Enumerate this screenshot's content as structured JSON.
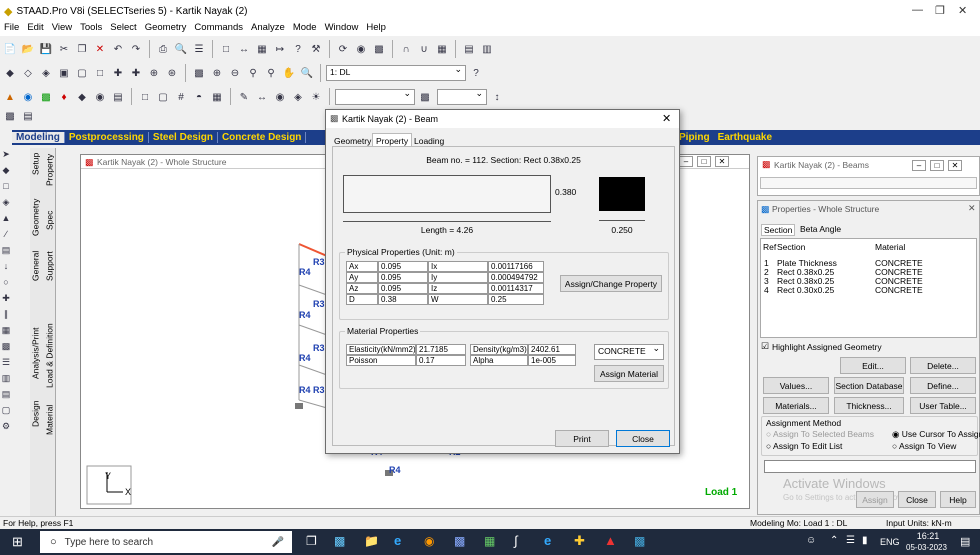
{
  "app": {
    "title": "STAAD.Pro V8i (SELECTseries 5) - Kartik Nayak (2)",
    "menu": [
      "File",
      "Edit",
      "View",
      "Tools",
      "Select",
      "Geometry",
      "Commands",
      "Analyze",
      "Mode",
      "Window",
      "Help"
    ],
    "load_combo": "1: DL"
  },
  "page_tabs": [
    "Modeling",
    "Postprocessing",
    "Steel Design",
    "Concrete Design"
  ],
  "page_tabs_right": [
    "Piping",
    "Earthquake"
  ],
  "side_tabs": [
    "Setup",
    "Property",
    "Geometry",
    "Spec",
    "General",
    "Support",
    "Analysis/Print",
    "Load & Definition",
    "Design",
    "Material"
  ],
  "structure_window": {
    "title": "Kartik Nayak (2) - Whole Structure",
    "labels": [
      "R3",
      "R4",
      "R3",
      "R4",
      "R3",
      "R4",
      "R4",
      "R3",
      "R4",
      "R4",
      "R2"
    ],
    "load_label": "Load 1",
    "axis_y": "Y",
    "axis_x": "X"
  },
  "beams_window": {
    "title": "Kartik Nayak (2) - Beams"
  },
  "properties_window": {
    "title": "Properties - Whole Structure",
    "tabs": [
      "Section",
      "Beta Angle"
    ],
    "columns": [
      "Ref",
      "Section",
      "Material"
    ],
    "rows": [
      {
        "ref": "1",
        "section": "Plate Thickness",
        "material": "CONCRETE"
      },
      {
        "ref": "2",
        "section": "Rect 0.38x0.25",
        "material": "CONCRETE"
      },
      {
        "ref": "3",
        "section": "Rect 0.38x0.25",
        "material": "CONCRETE"
      },
      {
        "ref": "4",
        "section": "Rect 0.30x0.25",
        "material": "CONCRETE"
      }
    ],
    "highlight_label": "Highlight Assigned Geometry",
    "buttons": {
      "edit": "Edit...",
      "delete": "Delete...",
      "values": "Values...",
      "section_db": "Section Database",
      "define": "Define...",
      "materials": "Materials...",
      "thickness": "Thickness...",
      "user_table": "User Table...",
      "assign": "Assign",
      "close": "Close",
      "help": "Help"
    },
    "assignment_method": "Assignment Method",
    "radio": [
      "Assign To Selected Beams",
      "Use Cursor To Assign",
      "Assign To Edit List",
      "Assign To View"
    ],
    "watermark": "Activate Windows",
    "watermark_sub": "Go to Settings to activate Windows."
  },
  "dialog": {
    "title": "Kartik Nayak (2) - Beam",
    "tabs": [
      "Geometry",
      "Property",
      "Loading"
    ],
    "beam_info": "Beam no. = 112. Section: Rect 0.38x0.25",
    "depth": "0.380",
    "width": "0.250",
    "length": "Length = 4.26",
    "physical_title": "Physical Properties (Unit: m)",
    "physical": [
      {
        "k": "Ax",
        "v": "0.095",
        "k2": "Ix",
        "v2": "0.00117166"
      },
      {
        "k": "Ay",
        "v": "0.095",
        "k2": "Iy",
        "v2": "0.000494792"
      },
      {
        "k": "Az",
        "v": "0.095",
        "k2": "Iz",
        "v2": "0.00114317"
      },
      {
        "k": "D",
        "v": "0.38",
        "k2": "W",
        "v2": "0.25"
      }
    ],
    "assign_change": "Assign/Change Property",
    "material_title": "Material Properties",
    "material": [
      {
        "k": "Elasticity(kN/mm2)",
        "v": "21.7185",
        "k2": "Density(kg/m3)",
        "v2": "2402.61"
      },
      {
        "k": "Poisson",
        "v": "0.17",
        "k2": "Alpha",
        "v2": "1e-005"
      }
    ],
    "material_select": "CONCRETE",
    "assign_material": "Assign Material",
    "print": "Print",
    "close": "Close"
  },
  "status": {
    "left": "For Help, press F1",
    "mid": "Modeling Mo: Load 1 : DL",
    "right": "Input Units: kN-m"
  },
  "taskbar": {
    "search": "Type here to search",
    "lang": "ENG",
    "time": "16:21",
    "date": "05-03-2023"
  }
}
